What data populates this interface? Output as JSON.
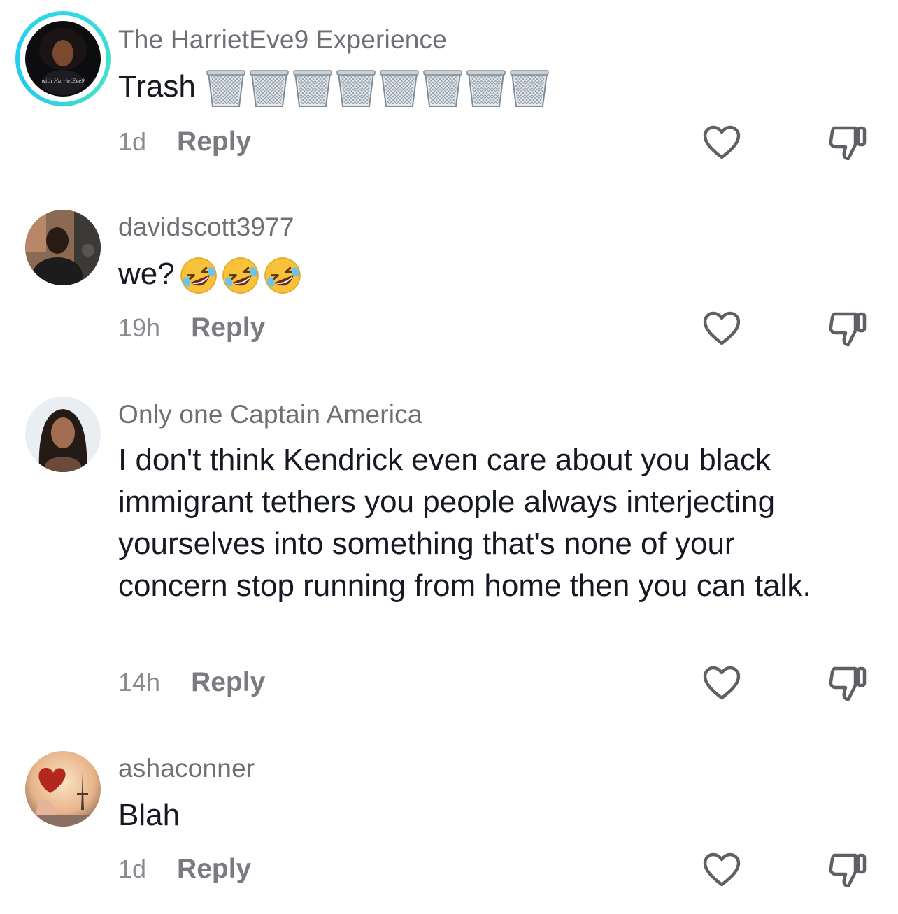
{
  "comments": [
    {
      "username": "The HarrietEve9 Experience",
      "text": "Trash",
      "emoji": [
        "wastebasket-emoji",
        "wastebasket-emoji",
        "wastebasket-emoji",
        "wastebasket-emoji",
        "wastebasket-emoji",
        "wastebasket-emoji",
        "wastebasket-emoji",
        "wastebasket-emoji"
      ],
      "time": "1d",
      "reply_label": "Reply",
      "avatar_caption": "with HarrietEve9",
      "has_story_ring": true
    },
    {
      "username": "davidscott3977",
      "text": "we?",
      "emoji": [
        "rolling-laughing-emoji",
        "rolling-laughing-emoji",
        "rolling-laughing-emoji"
      ],
      "time": "19h",
      "reply_label": "Reply"
    },
    {
      "username": "Only one Captain America",
      "text": "I don't think Kendrick even care about you black immigrant tethers you people always interjecting yourselves into something that's none of your concern stop running from home then you can talk.",
      "time": "14h",
      "reply_label": "Reply"
    },
    {
      "username": "ashaconner",
      "text": "Blah",
      "time": "1d",
      "reply_label": "Reply"
    }
  ],
  "icons": {
    "like": "heart-outline-icon",
    "dislike": "thumbs-down-outline-icon"
  },
  "colors": {
    "username": "#6e6f75",
    "text": "#161823",
    "meta": "#8a8b91",
    "icon": "#5f6066",
    "story_ring": "#2fd8e8"
  }
}
